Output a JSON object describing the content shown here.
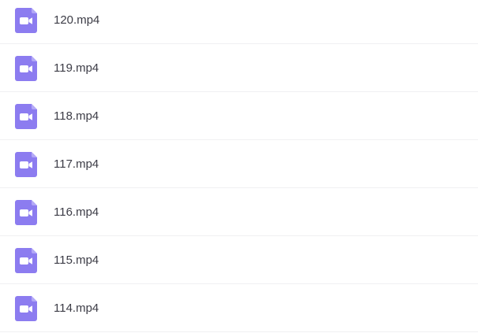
{
  "files": [
    {
      "name": "120.mp4",
      "icon": "video-file-icon"
    },
    {
      "name": "119.mp4",
      "icon": "video-file-icon"
    },
    {
      "name": "118.mp4",
      "icon": "video-file-icon"
    },
    {
      "name": "117.mp4",
      "icon": "video-file-icon"
    },
    {
      "name": "116.mp4",
      "icon": "video-file-icon"
    },
    {
      "name": "115.mp4",
      "icon": "video-file-icon"
    },
    {
      "name": "114.mp4",
      "icon": "video-file-icon"
    }
  ],
  "colors": {
    "icon_body": "#8c7cf0",
    "icon_fold": "#b3a8f7",
    "icon_glyph": "#ffffff",
    "text": "#3c3c46",
    "divider": "#f0f0f2"
  }
}
